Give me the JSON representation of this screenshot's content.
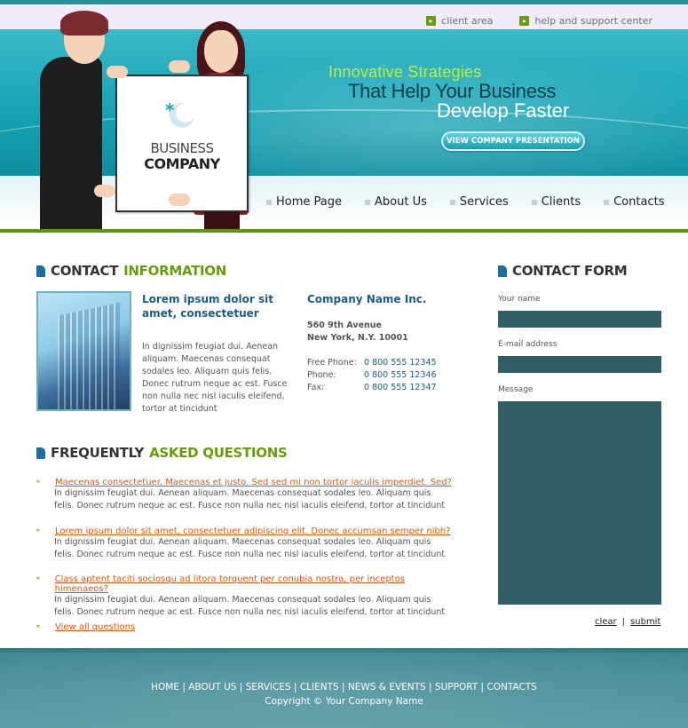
{
  "top_links": [
    {
      "label": "client area",
      "icon": "arrow-right-icon"
    },
    {
      "label": "help and support center",
      "icon": "arrow-right-icon"
    }
  ],
  "logo": {
    "line1": "BUSINESS",
    "line2": "COMPANY"
  },
  "hero": {
    "line1": "Innovative Strategies",
    "line2": "That Help Your Business",
    "line3": "Develop Faster",
    "button": "VIEW COMPANY PRESENTATION"
  },
  "nav": [
    "Home Page",
    "About Us",
    "Services",
    "Clients",
    "Contacts"
  ],
  "contact_info": {
    "heading_a": "CONTACT",
    "heading_b": "INFORMATION",
    "intro_title": "Lorem ipsum dolor sit amet, consectetuer",
    "intro_text": "In dignissim feugiat dui. Aenean aliquam. Maecenas consequat sodales leo. Aliquam quis felis. Donec rutrum neque ac est. Fusce non nulla nec nisl iaculis eleifend, tortor at tincidunt",
    "company": "Company Name Inc.",
    "address1": "560 9th Avenue",
    "address2": "New York, N.Y. 10001",
    "phones": [
      {
        "label": "Free Phone:",
        "value": "0 800 555 12345"
      },
      {
        "label": "Phone:",
        "value": "0 800 555 12346"
      },
      {
        "label": "Fax:",
        "value": "0 800 555 12347"
      }
    ]
  },
  "faq": {
    "heading_a": "FREQUENTLY",
    "heading_b": "ASKED QUESTIONS",
    "items": [
      {
        "q": "Maecenas consectetuer. Maecenas et justo. Sed sed mi non tortor iaculis imperdiet. Sed?",
        "a": "In dignissim feugiat dui. Aenean aliquam. Maecenas consequat sodales leo. Aliquam quis felis. Donec rutrum neque ac est. Fusce non nulla nec nisl iaculis eleifend, tortor at tincidunt"
      },
      {
        "q": "Lorem ipsum dolor sit amet, consectetuer adipiscing elit. Donec accumsan semper nibh?",
        "a": "In dignissim feugiat dui. Aenean aliquam. Maecenas consequat sodales leo. Aliquam quis felis. Donec rutrum neque ac est. Fusce non nulla nec nisl iaculis eleifend, tortor at tincidunt"
      },
      {
        "q": "Class aptent taciti sociosqu ad litora torquent per conubia nostra, per inceptos himenaeos?",
        "a": "In dignissim feugiat dui. Aenean aliquam. Maecenas consequat sodales leo. Aliquam quis felis. Donec rutrum neque ac est. Fusce non nulla nec nisl iaculis eleifend, tortor at tincidunt"
      }
    ],
    "view_all": "View all questions"
  },
  "contact_form": {
    "heading": "CONTACT FORM",
    "name_label": "Your name",
    "email_label": "E-mail address",
    "message_label": "Message",
    "clear": "clear",
    "separator": "|",
    "submit": "submit"
  },
  "footer": {
    "links": [
      "HOME",
      "ABOUT US",
      "SERVICES",
      "CLIENTS",
      "NEWS & EVENTS",
      "SUPPORT",
      "CONTACTS"
    ],
    "separator": " | ",
    "copyright": "Copyright © Your Company Name"
  },
  "colors": {
    "teal": "#16a3b4",
    "green": "#6a9a12",
    "orange_link": "#d55a0f",
    "form_field": "#2f5f64",
    "dark_blue": "#1d5c80"
  }
}
